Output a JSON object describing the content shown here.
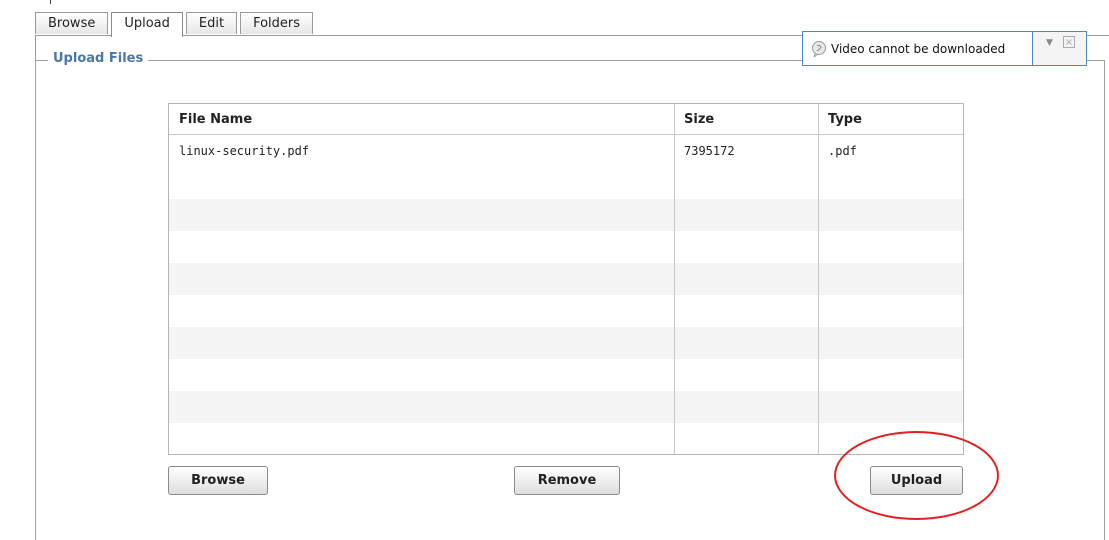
{
  "tabs": [
    {
      "label": "Browse",
      "active": false
    },
    {
      "label": "Upload",
      "active": true
    },
    {
      "label": "Edit",
      "active": false
    },
    {
      "label": "Folders",
      "active": false
    }
  ],
  "panel": {
    "legend": "Upload Files"
  },
  "notification": {
    "text": "Video cannot be downloaded",
    "icon": "speech-bubble-icon"
  },
  "table": {
    "headers": [
      "File Name",
      "Size",
      "Type"
    ],
    "rows": [
      {
        "name": "linux-security.pdf",
        "size": "7395172",
        "type": ".pdf"
      }
    ]
  },
  "buttons": {
    "browse": "Browse",
    "remove": "Remove",
    "upload": "Upload"
  },
  "colors": {
    "legend": "#4a77a8",
    "highlight_circle": "#e02020",
    "notify_border": "#4a86c8"
  }
}
